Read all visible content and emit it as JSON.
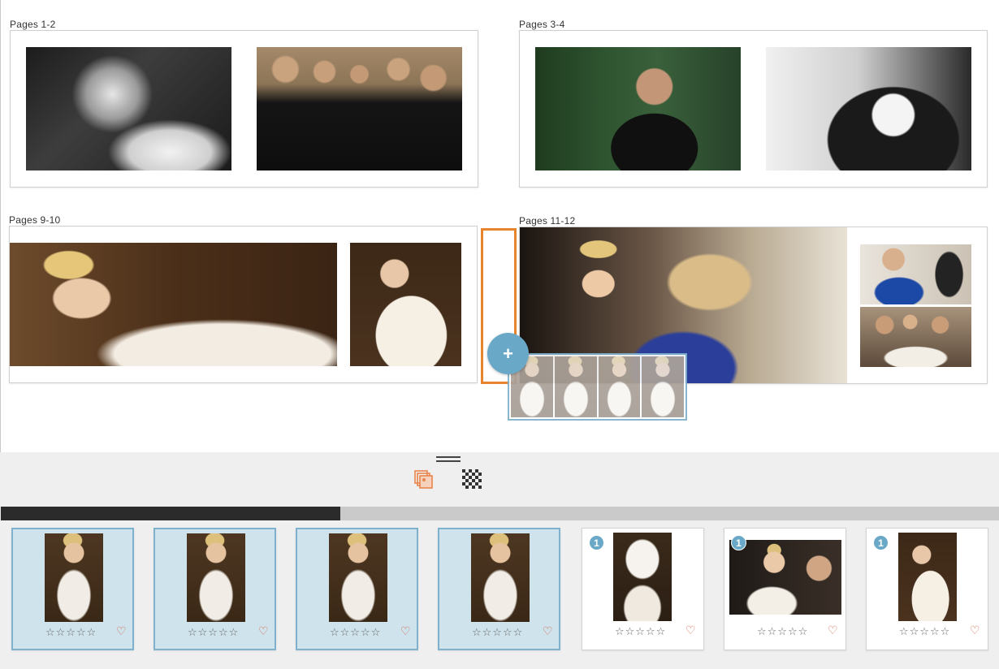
{
  "spreads": [
    {
      "label": "Pages 1-2"
    },
    {
      "label": "Pages 3-4"
    },
    {
      "label": "Pages 9-10"
    },
    {
      "label": "Pages 11-12"
    }
  ],
  "drop_target": {
    "add_symbol": "+"
  },
  "panel": {
    "modes": [
      "spreads-mode-icon",
      "grid-mode-icon"
    ],
    "progress_percent": 34
  },
  "filmstrip": {
    "cards": [
      {
        "selected": true,
        "badge": "",
        "stars": "☆☆☆☆☆",
        "heart": "♡",
        "icon": "photo-thumbnail"
      },
      {
        "selected": true,
        "badge": "",
        "stars": "☆☆☆☆☆",
        "heart": "♡",
        "icon": "photo-thumbnail"
      },
      {
        "selected": true,
        "badge": "",
        "stars": "☆☆☆☆☆",
        "heart": "♡",
        "icon": "photo-thumbnail"
      },
      {
        "selected": true,
        "badge": "",
        "stars": "☆☆☆☆☆",
        "heart": "♡",
        "icon": "photo-thumbnail"
      },
      {
        "selected": false,
        "badge": "1",
        "stars": "☆☆☆☆☆",
        "heart": "♡",
        "icon": "photo-thumbnail"
      },
      {
        "selected": false,
        "badge": "1",
        "stars": "☆☆☆☆☆",
        "heart": "♡",
        "icon": "photo-thumbnail"
      },
      {
        "selected": false,
        "badge": "1",
        "stars": "☆☆☆☆☆",
        "heart": "♡",
        "icon": "photo-thumbnail"
      }
    ]
  },
  "colors": {
    "accent_blue": "#6aa8c8",
    "selection_bg": "#cfe3ec",
    "drop_orange": "#e8842c",
    "heart": "#d4644c"
  }
}
